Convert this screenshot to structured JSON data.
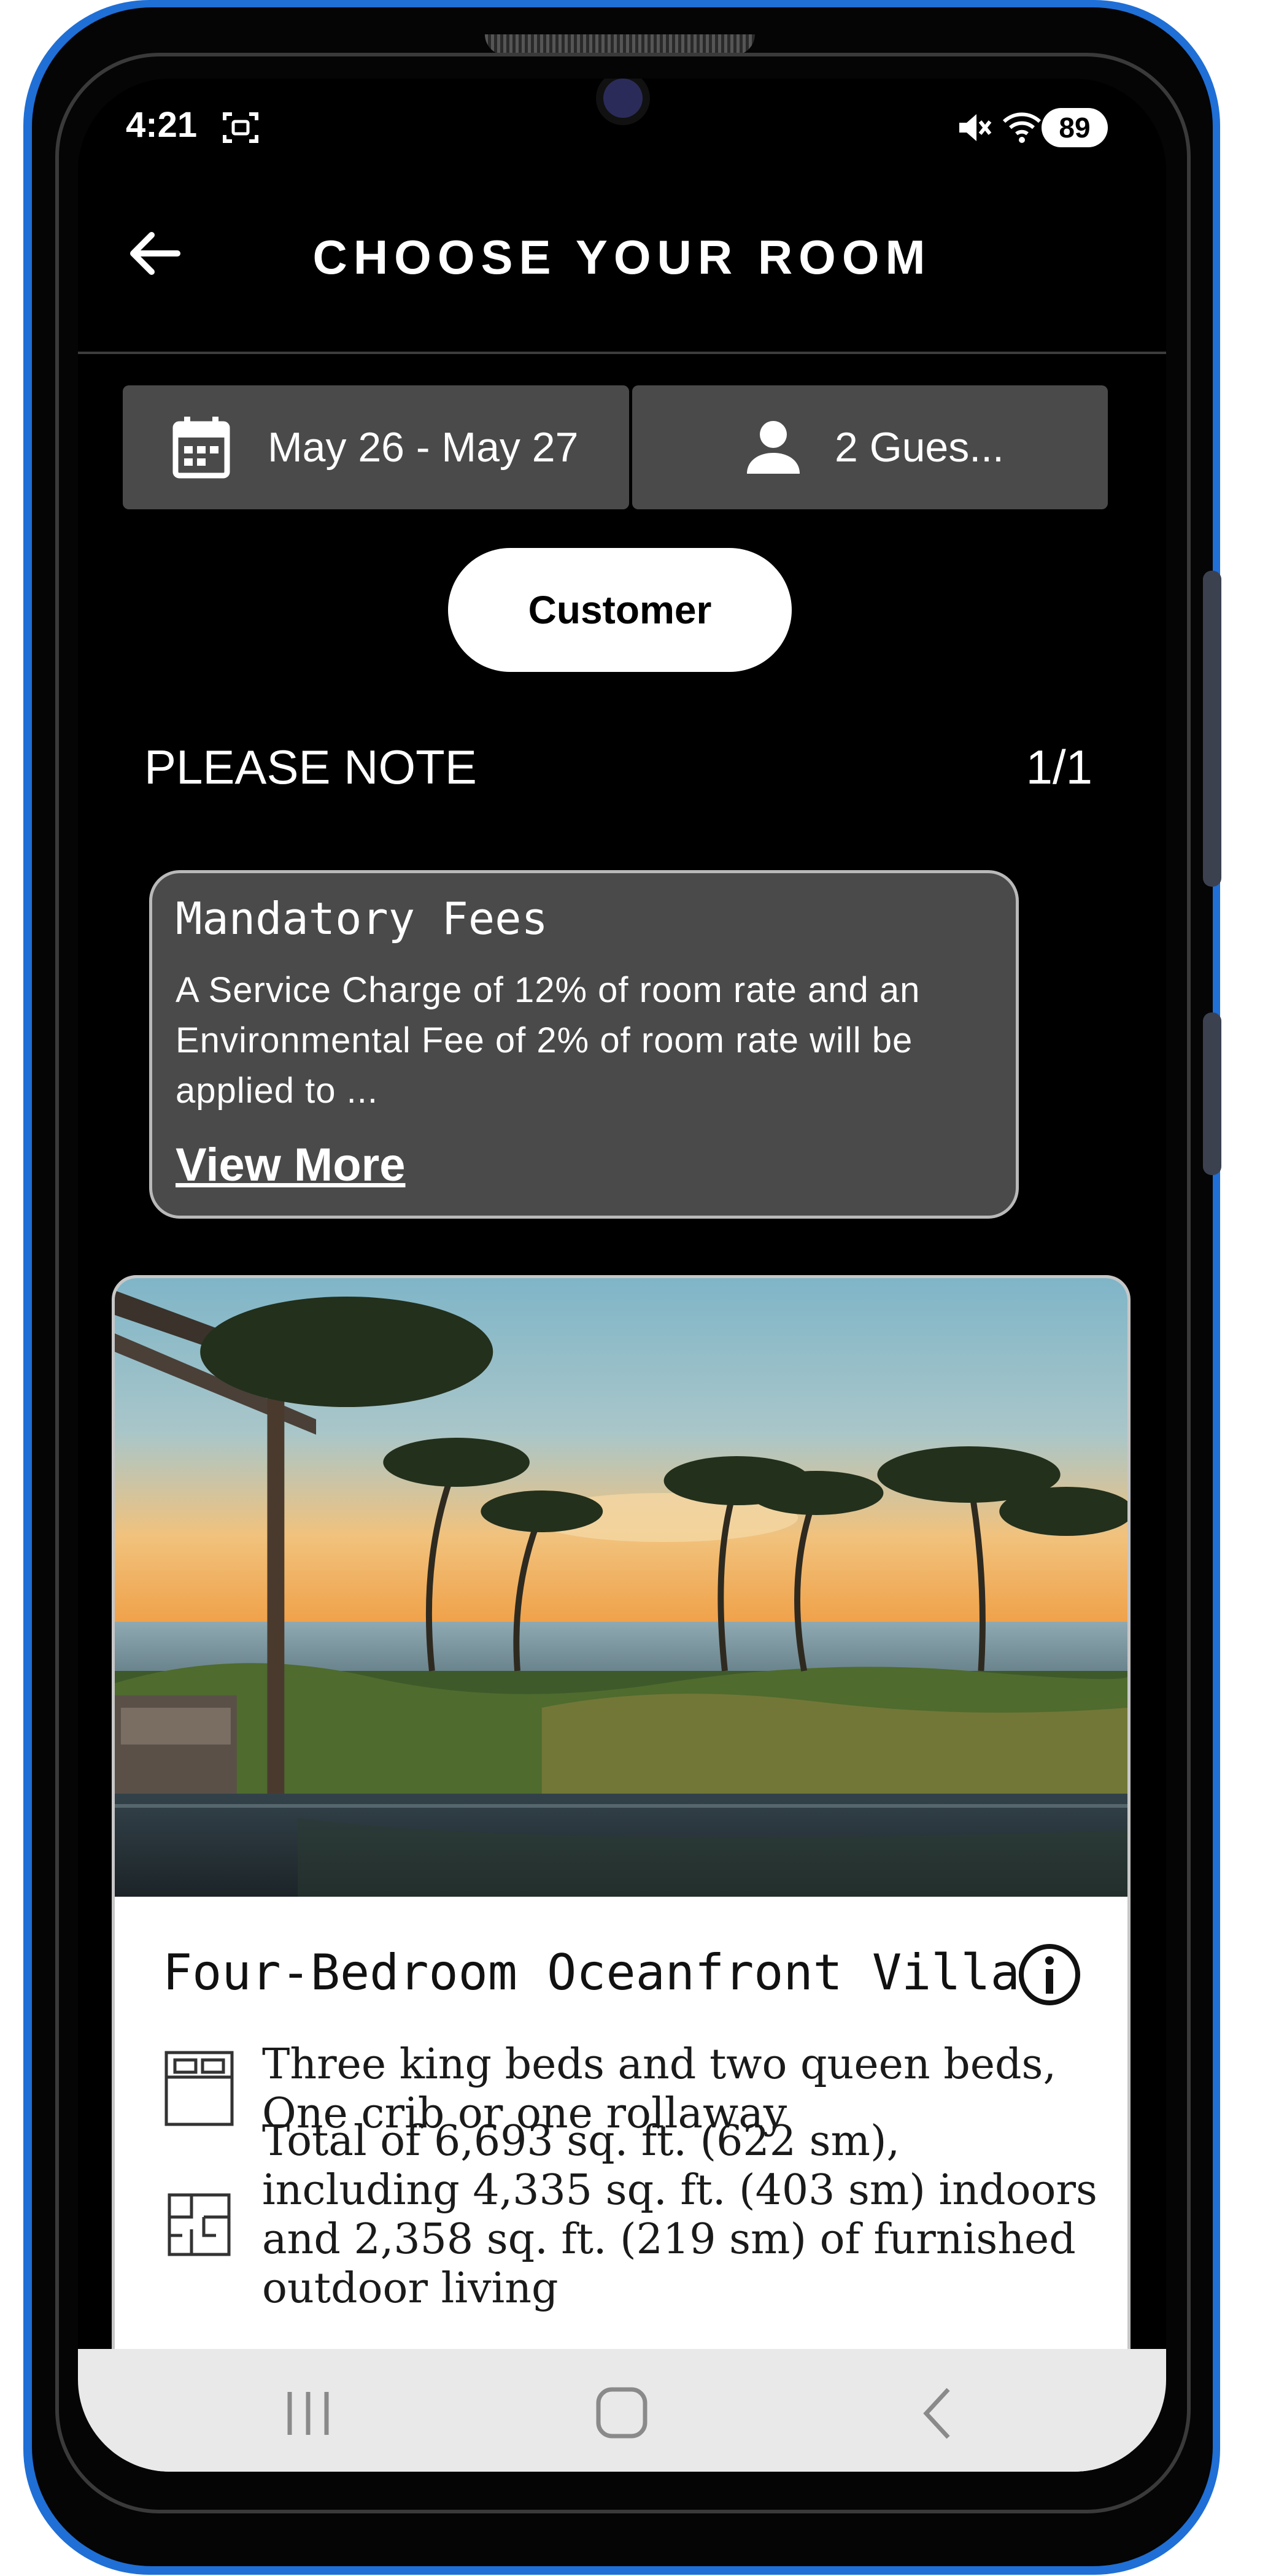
{
  "status_bar": {
    "time": "4:21",
    "battery": "89",
    "icons": [
      "screenshot-icon",
      "mute-icon",
      "wifi-icon",
      "signal-icon"
    ]
  },
  "header": {
    "title": "CHOOSE YOUR ROOM",
    "back_icon": "arrow-left-icon"
  },
  "booking": {
    "dates": "May 26 - May 27",
    "guests": "2 Gues...",
    "date_icon": "calendar-icon",
    "guest_icon": "person-icon"
  },
  "rate_type": {
    "label": "Customer"
  },
  "notes": {
    "heading": "PLEASE NOTE",
    "count": "1/1",
    "card": {
      "title": "Mandatory Fees",
      "text": "A Service Charge of 12% of room rate and an Environmental Fee of 2% of room rate will be applied to ...",
      "link": "View More"
    }
  },
  "room": {
    "name": "Four-Bedroom Oceanfront Villa",
    "info_icon": "info-icon",
    "features": [
      {
        "icon": "bed-icon",
        "lines": [
          "Three king beds and two queen beds,",
          "One crib or one rollaway"
        ]
      },
      {
        "icon": "floorplan-icon",
        "lines": [
          "Total of 6,693 sq. ft. (622 sm),",
          "including 4,335 sq. ft. (403 sm) indoors",
          "and 2,358 sq. ft. (219 sm) of furnished",
          "outdoor living"
        ]
      }
    ]
  },
  "nav_bar": {
    "buttons": [
      "recent-apps-icon",
      "home-icon",
      "back-icon"
    ]
  },
  "colors": {
    "frame": "#1f6fd6",
    "screen_bg": "#000000",
    "card_bg": "#4a4a4a",
    "accent_text": "#ffffff"
  }
}
